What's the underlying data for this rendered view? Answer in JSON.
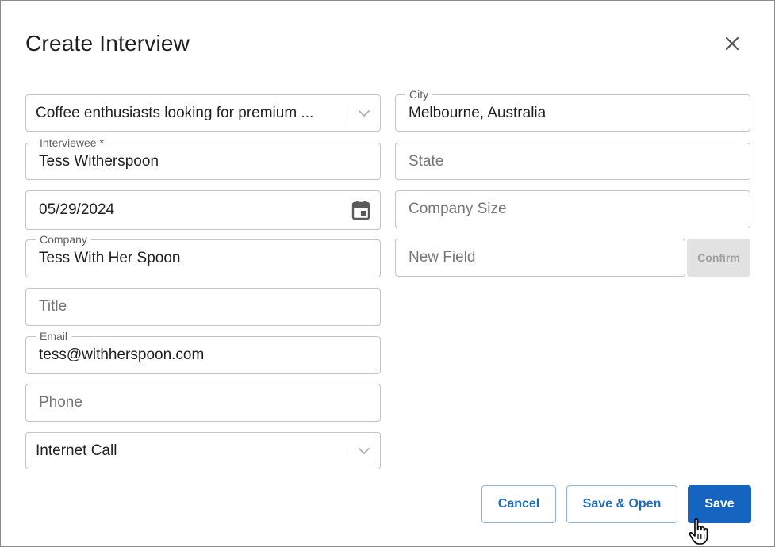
{
  "dialog": {
    "title": "Create Interview"
  },
  "left_column": {
    "segment_select": {
      "value": "Coffee enthusiasts looking for premium ..."
    },
    "interviewee": {
      "label": "Interviewee *",
      "value": "Tess Witherspoon"
    },
    "date": {
      "value": "05/29/2024"
    },
    "company": {
      "label": "Company",
      "value": "Tess With Her Spoon"
    },
    "title_field": {
      "placeholder": "Title"
    },
    "email": {
      "label": "Email",
      "value": "tess@withherspoon.com"
    },
    "phone": {
      "placeholder": "Phone"
    },
    "call_type_select": {
      "value": "Internet Call"
    }
  },
  "right_column": {
    "city": {
      "label": "City",
      "value": "Melbourne, Australia"
    },
    "state": {
      "placeholder": "State"
    },
    "company_size": {
      "placeholder": "Company Size"
    },
    "new_field": {
      "placeholder": "New Field",
      "confirm_label": "Confirm"
    }
  },
  "footer": {
    "cancel_label": "Cancel",
    "save_open_label": "Save & Open",
    "save_label": "Save"
  },
  "colors": {
    "primary": "#1565c0",
    "outline_border": "#89b4dc",
    "disabled_bg": "#e2e2e2"
  },
  "icons": {
    "close": "close-icon",
    "chevron": "chevron-down-icon",
    "calendar": "calendar-icon",
    "cursor": "hand-pointer-icon"
  }
}
